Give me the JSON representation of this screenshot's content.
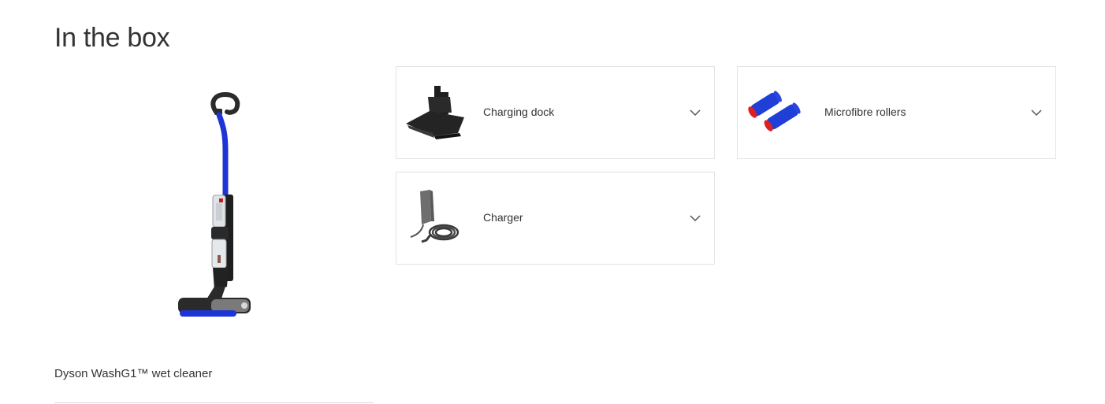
{
  "section": {
    "title": "In the box"
  },
  "hero": {
    "image_name": "wet-cleaner-image",
    "caption": "Dyson WashG1™ wet cleaner"
  },
  "items": [
    {
      "label": "Charging dock",
      "icon": "charging-dock-image",
      "expanded": false
    },
    {
      "label": "Microfibre rollers",
      "icon": "microfibre-rollers-image",
      "expanded": false
    },
    {
      "label": "Charger",
      "icon": "charger-image",
      "expanded": false
    }
  ],
  "colors": {
    "text": "#333333",
    "border": "#e3e3e3",
    "accent_blue": "#1e34d6",
    "roller_red": "#e02020"
  }
}
